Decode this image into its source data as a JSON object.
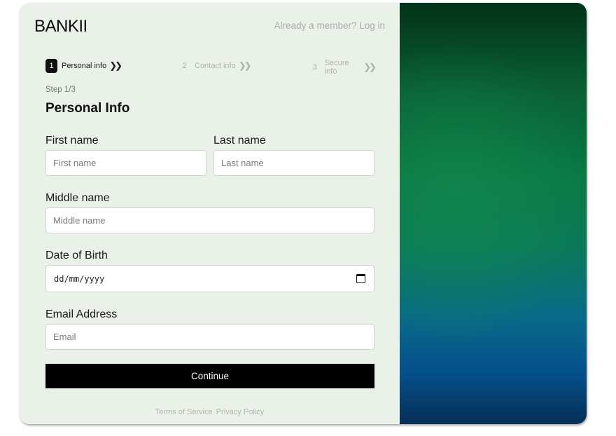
{
  "brand": {
    "name": "BANKII"
  },
  "header": {
    "login_link": "Already a member? Log in"
  },
  "steps": [
    {
      "number": "1",
      "label": "Personal info",
      "active": true
    },
    {
      "number": "2",
      "label": "Contact info",
      "active": false
    },
    {
      "number": "3",
      "label": "Secure info",
      "active": false
    }
  ],
  "form": {
    "step_indicator": "Step 1/3",
    "title": "Personal Info",
    "first_name": {
      "label": "First name",
      "placeholder": "First name"
    },
    "last_name": {
      "label": "Last name",
      "placeholder": "Last name"
    },
    "middle_name": {
      "label": "Middle name",
      "placeholder": "Middle name"
    },
    "dob": {
      "label": "Date of Birth",
      "placeholder": "dd/mm/yyyy"
    },
    "email": {
      "label": "Email Address",
      "placeholder": "Email"
    },
    "submit_label": "Continue"
  },
  "footer": {
    "terms": "Terms of Service",
    "privacy": "Privacy Policy"
  },
  "icons": {
    "calendar": "calendar-icon",
    "step_chevron": "double-chevron-right-icon"
  },
  "colors": {
    "panel_bg": "#eaf1e8",
    "button_bg": "#000000",
    "gradient_top": "#03321a",
    "gradient_bottom": "#064f8c"
  }
}
